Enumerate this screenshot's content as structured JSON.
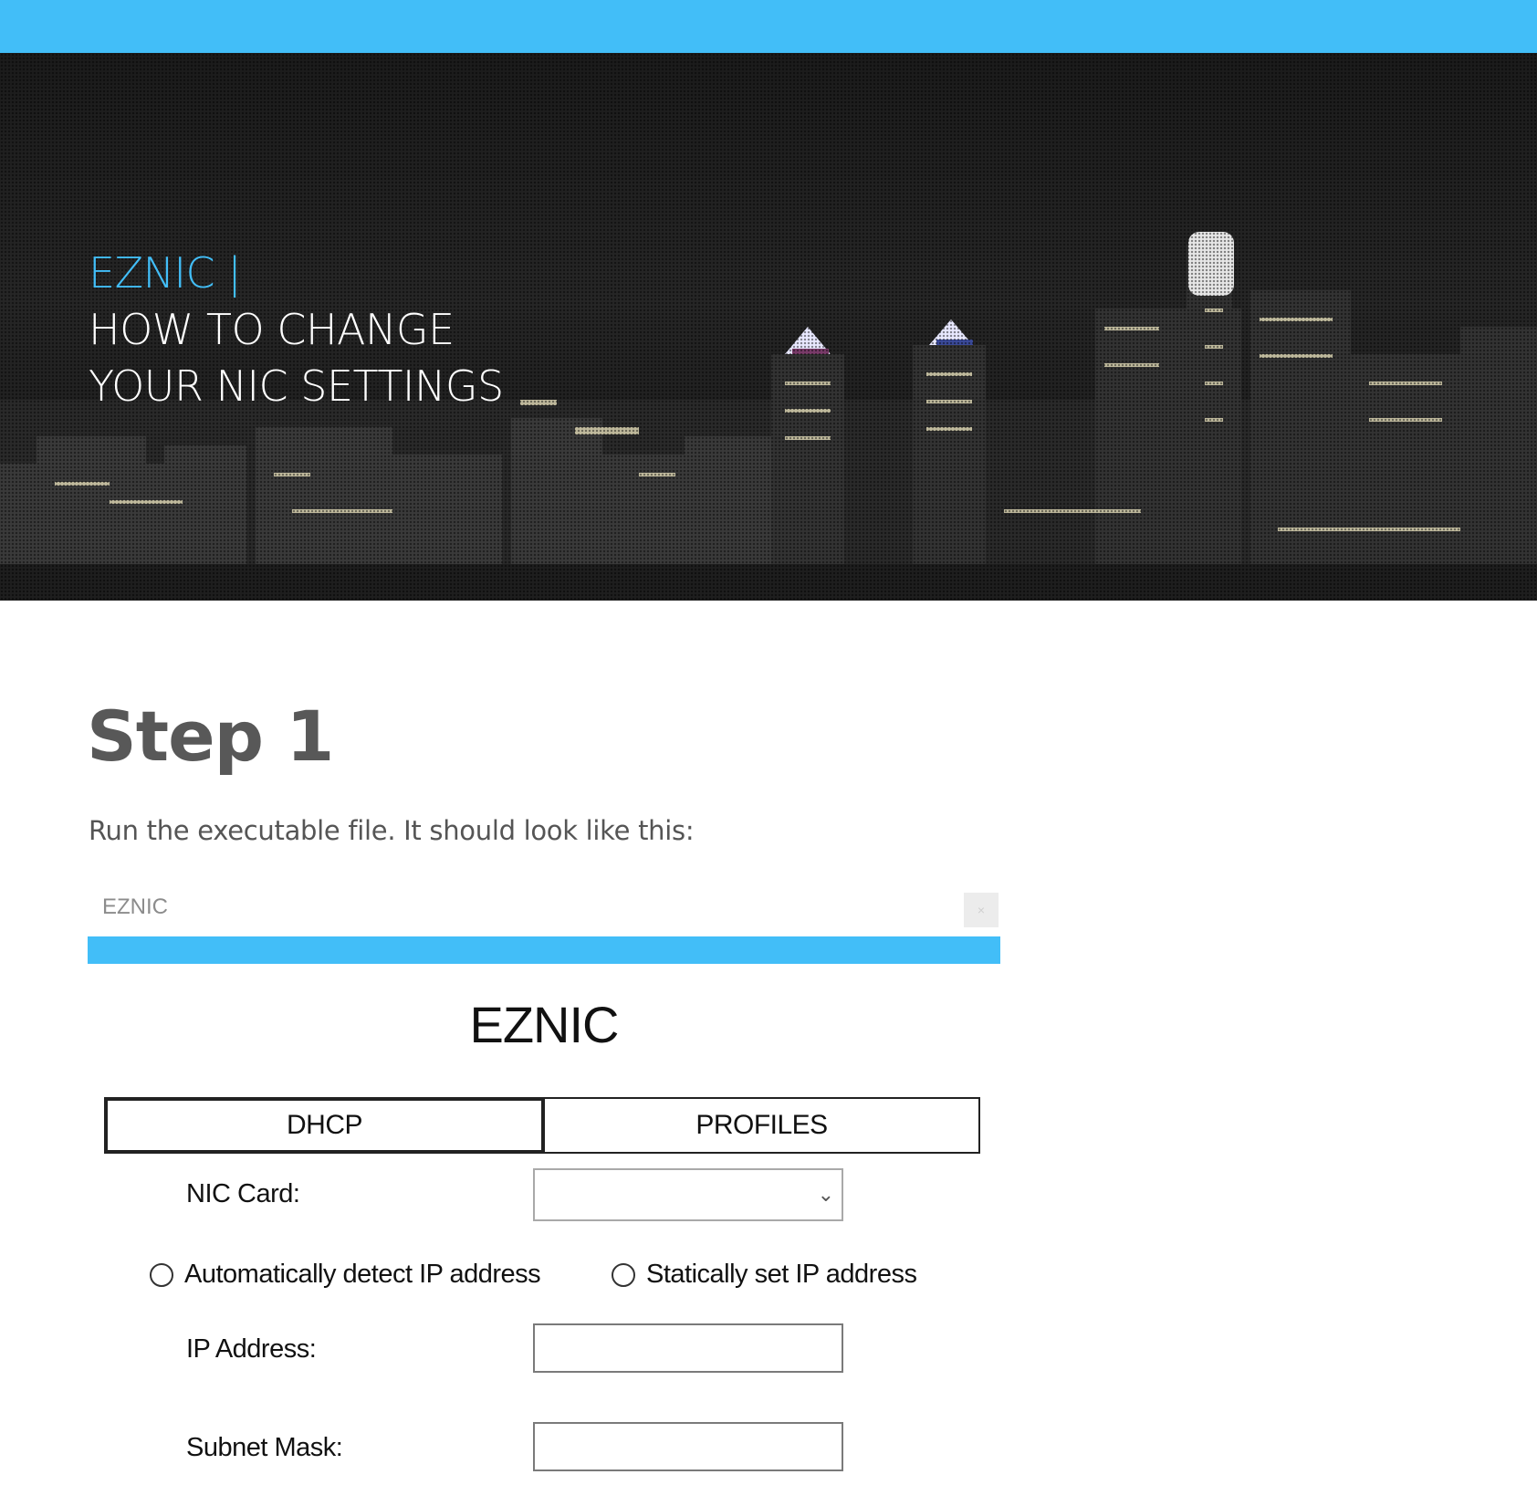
{
  "colors": {
    "accent": "#42bef8",
    "heading_gray": "#585858"
  },
  "hero": {
    "title_line1": "EZNIC |",
    "title_line2": "HOW TO CHANGE",
    "title_line3": "YOUR NIC SETTINGS"
  },
  "step": {
    "title": "Step 1",
    "description": "Run the executable file. It should look like this:"
  },
  "app": {
    "window_title": "EZNIC",
    "close_icon": "×",
    "heading": "EZNIC",
    "tabs": [
      {
        "label": "DHCP",
        "active": true
      },
      {
        "label": "PROFILES",
        "active": false
      }
    ],
    "nic_card_label": "NIC Card:",
    "nic_card_value": "",
    "radio_auto_label": "Automatically detect IP address",
    "radio_static_label": "Statically set IP address",
    "ip_address_label": "IP Address:",
    "ip_address_value": "",
    "subnet_mask_label": "Subnet Mask:",
    "subnet_mask_value": ""
  }
}
